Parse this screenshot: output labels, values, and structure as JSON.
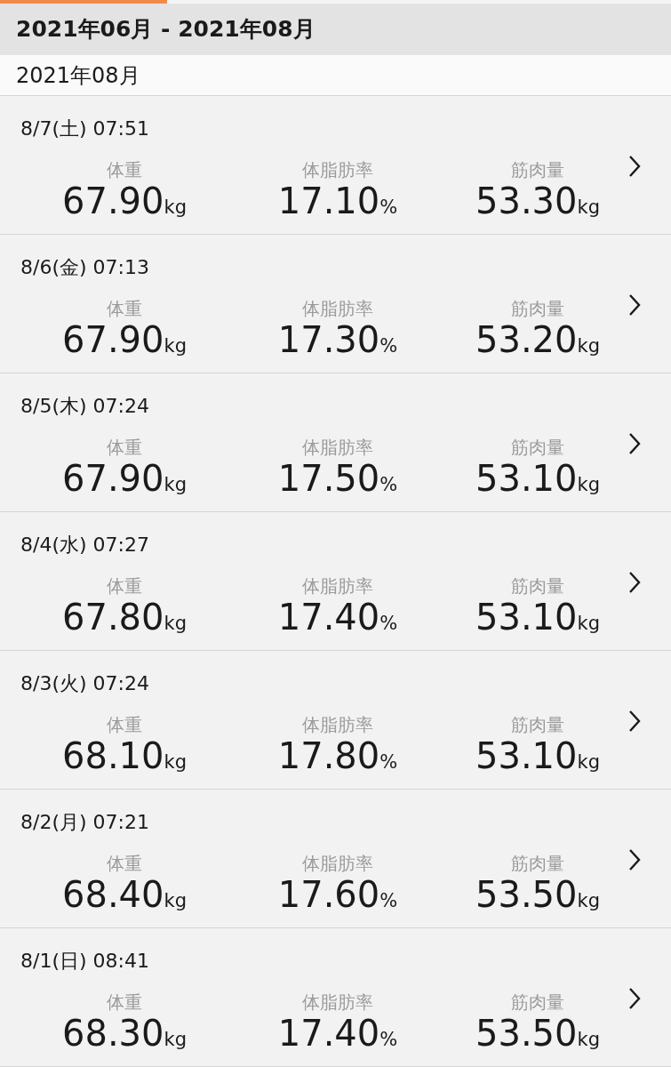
{
  "range_header": "2021年06月 - 2021年08月",
  "month_header": "2021年08月",
  "entries": [
    {
      "date": "8/7(土) 07:51",
      "metrics": [
        {
          "label": "体重",
          "value": "67.90",
          "unit": "kg"
        },
        {
          "label": "体脂肪率",
          "value": "17.10",
          "unit": "%"
        },
        {
          "label": "筋肉量",
          "value": "53.30",
          "unit": "kg"
        }
      ]
    },
    {
      "date": "8/6(金) 07:13",
      "metrics": [
        {
          "label": "体重",
          "value": "67.90",
          "unit": "kg"
        },
        {
          "label": "体脂肪率",
          "value": "17.30",
          "unit": "%"
        },
        {
          "label": "筋肉量",
          "value": "53.20",
          "unit": "kg"
        }
      ]
    },
    {
      "date": "8/5(木) 07:24",
      "metrics": [
        {
          "label": "体重",
          "value": "67.90",
          "unit": "kg"
        },
        {
          "label": "体脂肪率",
          "value": "17.50",
          "unit": "%"
        },
        {
          "label": "筋肉量",
          "value": "53.10",
          "unit": "kg"
        }
      ]
    },
    {
      "date": "8/4(水) 07:27",
      "metrics": [
        {
          "label": "体重",
          "value": "67.80",
          "unit": "kg"
        },
        {
          "label": "体脂肪率",
          "value": "17.40",
          "unit": "%"
        },
        {
          "label": "筋肉量",
          "value": "53.10",
          "unit": "kg"
        }
      ]
    },
    {
      "date": "8/3(火) 07:24",
      "metrics": [
        {
          "label": "体重",
          "value": "68.10",
          "unit": "kg"
        },
        {
          "label": "体脂肪率",
          "value": "17.80",
          "unit": "%"
        },
        {
          "label": "筋肉量",
          "value": "53.10",
          "unit": "kg"
        }
      ]
    },
    {
      "date": "8/2(月) 07:21",
      "metrics": [
        {
          "label": "体重",
          "value": "68.40",
          "unit": "kg"
        },
        {
          "label": "体脂肪率",
          "value": "17.60",
          "unit": "%"
        },
        {
          "label": "筋肉量",
          "value": "53.50",
          "unit": "kg"
        }
      ]
    },
    {
      "date": "8/1(日) 08:41",
      "metrics": [
        {
          "label": "体重",
          "value": "68.30",
          "unit": "kg"
        },
        {
          "label": "体脂肪率",
          "value": "17.40",
          "unit": "%"
        },
        {
          "label": "筋肉量",
          "value": "53.50",
          "unit": "kg"
        }
      ]
    }
  ]
}
